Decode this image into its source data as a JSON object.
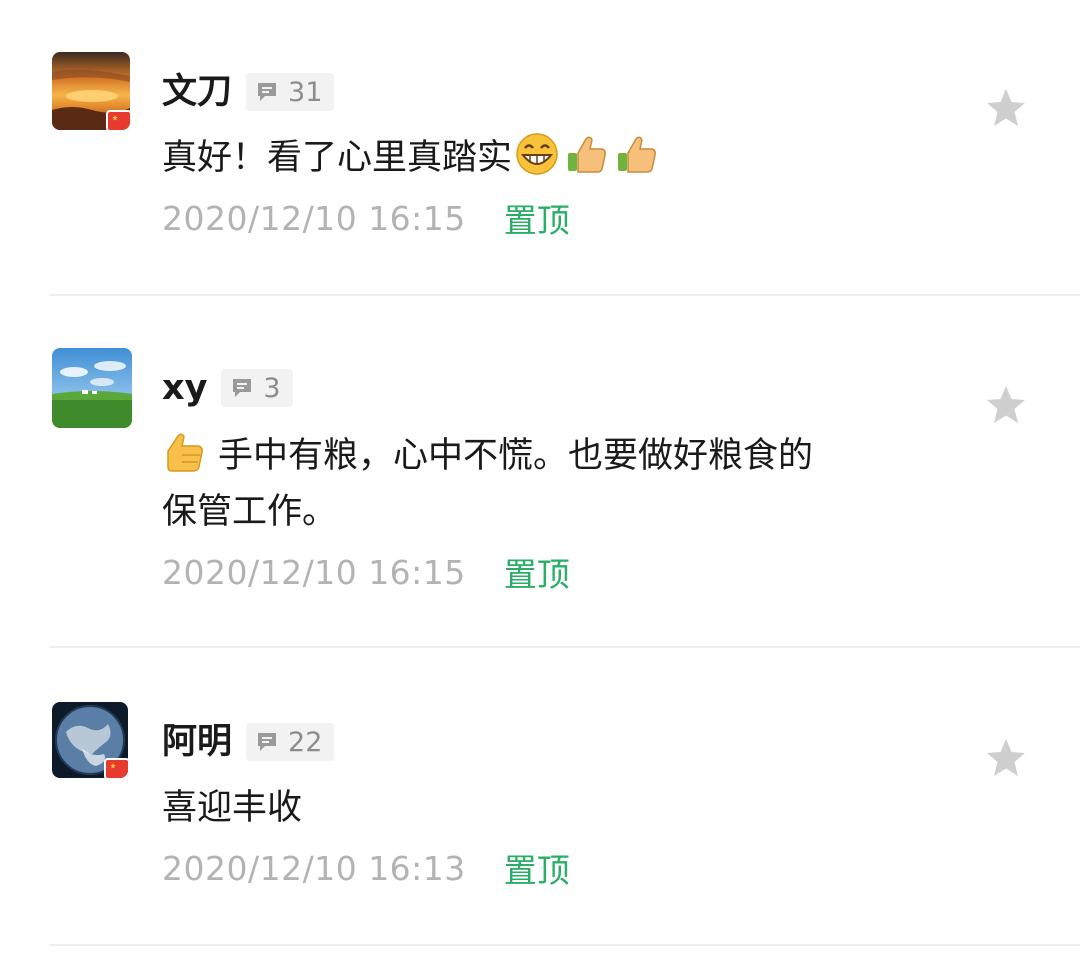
{
  "comments": [
    {
      "username": "文刀",
      "reply_count": "31",
      "text_before": "真好！看了心里真踏实",
      "emojis": [
        "grin-emoji",
        "thumbs-up-emoji",
        "thumbs-up-emoji"
      ],
      "time": "2020/12/10 16:15",
      "action": "置顶",
      "avatar": "sunset-avatar",
      "has_flag": true
    },
    {
      "username": "xy",
      "reply_count": "3",
      "emoji_prefix": "thumbs-up-emoji",
      "text_line1": "手中有粮，心中不慌。也要做好粮食的",
      "text_line2": "保管工作。",
      "time": "2020/12/10 16:15",
      "action": "置顶",
      "avatar": "grassland-avatar",
      "has_flag": false
    },
    {
      "username": "阿明",
      "reply_count": "22",
      "text": "喜迎丰收",
      "time": "2020/12/10 16:13",
      "action": "置顶",
      "avatar": "earth-avatar",
      "has_flag": true
    }
  ],
  "colors": {
    "accent_green": "#2aae67",
    "time_gray": "#b3b3b3",
    "badge_bg": "#f2f2f2",
    "star_gray": "#cfcfcf"
  }
}
